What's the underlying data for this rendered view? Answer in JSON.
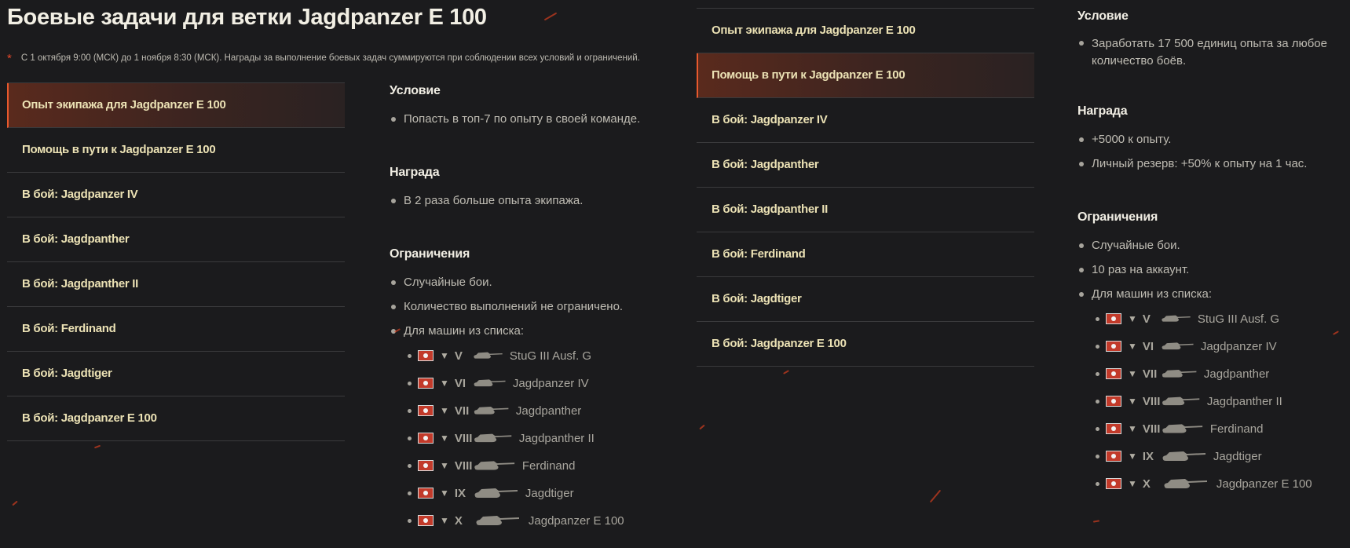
{
  "page_title": "Боевые задачи для ветки Jagdpanzer E 100",
  "date_note": "С 1 октября 9:00 (МСК) до 1 ноября 8:30 (МСК). Награды за выполнение боевых задач суммируются при соблюдении всех условий и ограничений.",
  "date_note_marker": "*",
  "colors": {
    "active_accent": "#e8592d",
    "quest_text": "#ebe1b4",
    "background": "#1b1b1d"
  },
  "left": {
    "quests": [
      {
        "label": "Опыт экипажа для Jagdpanzer E 100",
        "active": true
      },
      {
        "label": "Помощь в пути к Jagdpanzer E 100",
        "active": false
      },
      {
        "label": "В бой: Jagdpanzer IV",
        "active": false
      },
      {
        "label": "В бой: Jagdpanther",
        "active": false
      },
      {
        "label": "В бой: Jagdpanther II",
        "active": false
      },
      {
        "label": "В бой: Ferdinand",
        "active": false
      },
      {
        "label": "В бой: Jagdtiger",
        "active": false
      },
      {
        "label": "В бой: Jagdpanzer E 100",
        "active": false
      }
    ],
    "condition": {
      "heading": "Условие",
      "items": [
        "Попасть в топ-7 по опыту в своей команде."
      ]
    },
    "reward": {
      "heading": "Награда",
      "items": [
        "В 2 раза больше опыта экипажа."
      ]
    },
    "restrictions": {
      "heading": "Ограничения",
      "items": [
        "Случайные бои.",
        "Количество выполнений не ограничено.",
        "Для машин из списка:"
      ],
      "vehicles": [
        {
          "tier": "V",
          "name": "StuG III Ausf. G",
          "icon": "tank-icon"
        },
        {
          "tier": "VI",
          "name": "Jagdpanzer IV",
          "icon": "tank-icon"
        },
        {
          "tier": "VII",
          "name": "Jagdpanther",
          "icon": "tank-icon"
        },
        {
          "tier": "VIII",
          "name": "Jagdpanther II",
          "icon": "tank-icon"
        },
        {
          "tier": "VIII",
          "name": "Ferdinand",
          "icon": "tank-icon"
        },
        {
          "tier": "IX",
          "name": "Jagdtiger",
          "icon": "tank-icon"
        },
        {
          "tier": "X",
          "name": "Jagdpanzer E 100",
          "icon": "tank-icon"
        }
      ]
    }
  },
  "right": {
    "quests": [
      {
        "label": "Опыт экипажа для Jagdpanzer E 100",
        "active": false
      },
      {
        "label": "Помощь в пути к Jagdpanzer E 100",
        "active": true
      },
      {
        "label": "В бой: Jagdpanzer IV",
        "active": false
      },
      {
        "label": "В бой: Jagdpanther",
        "active": false
      },
      {
        "label": "В бой: Jagdpanther II",
        "active": false
      },
      {
        "label": "В бой: Ferdinand",
        "active": false
      },
      {
        "label": "В бой: Jagdtiger",
        "active": false
      },
      {
        "label": "В бой: Jagdpanzer E 100",
        "active": false
      }
    ],
    "condition": {
      "heading": "Условие",
      "items": [
        "Заработать 17 500 единиц опыта за любое количество боёв."
      ]
    },
    "reward": {
      "heading": "Награда",
      "items": [
        "+5000 к опыту.",
        "Личный резерв: +50% к опыту на 1 час."
      ]
    },
    "restrictions": {
      "heading": "Ограничения",
      "items": [
        "Случайные бои.",
        "10 раз на аккаунт.",
        "Для машин из списка:"
      ],
      "vehicles": [
        {
          "tier": "V",
          "name": "StuG III Ausf. G",
          "icon": "tank-icon"
        },
        {
          "tier": "VI",
          "name": "Jagdpanzer IV",
          "icon": "tank-icon"
        },
        {
          "tier": "VII",
          "name": "Jagdpanther",
          "icon": "tank-icon"
        },
        {
          "tier": "VIII",
          "name": "Jagdpanther II",
          "icon": "tank-icon"
        },
        {
          "tier": "VIII",
          "name": "Ferdinand",
          "icon": "tank-icon"
        },
        {
          "tier": "IX",
          "name": "Jagdtiger",
          "icon": "tank-icon"
        },
        {
          "tier": "X",
          "name": "Jagdpanzer E 100",
          "icon": "tank-icon"
        }
      ]
    }
  }
}
